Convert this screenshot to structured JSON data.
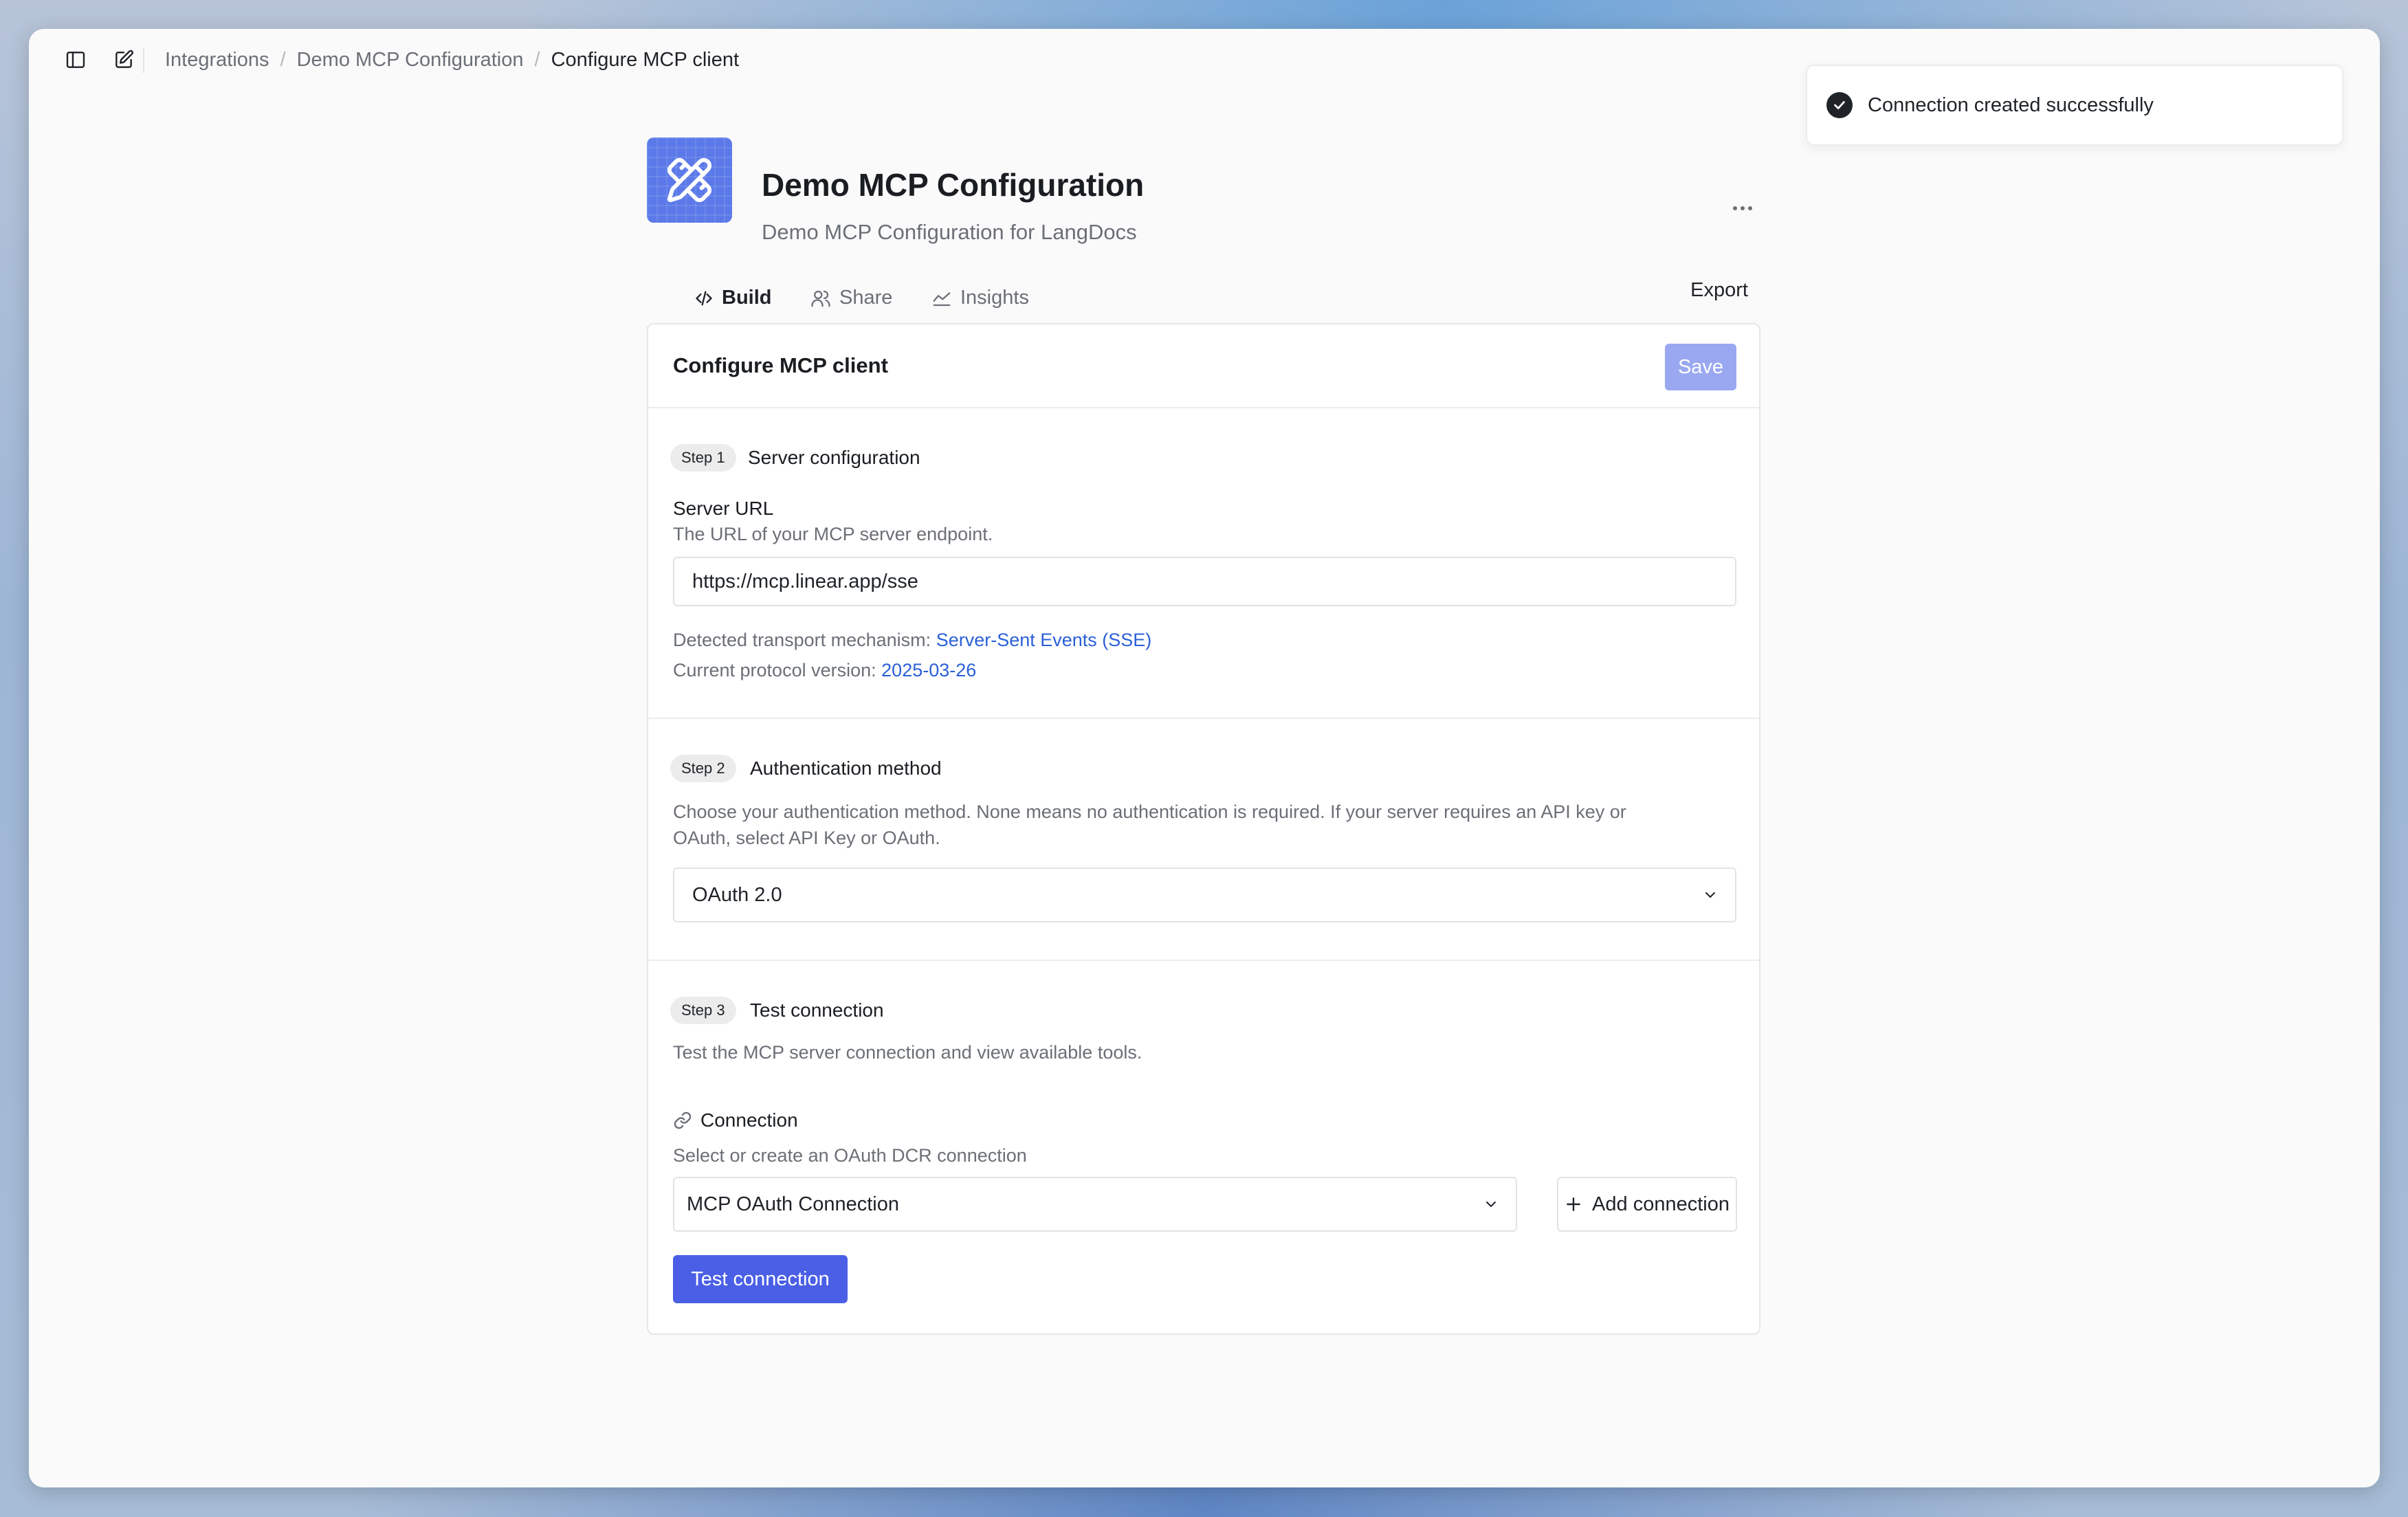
{
  "breadcrumb": {
    "items": [
      "Integrations",
      "Demo MCP Configuration"
    ],
    "current": "Configure MCP client"
  },
  "header": {
    "title": "Demo MCP Configuration",
    "subtitle": "Demo MCP Configuration for LangDocs",
    "logo_icon": "pencil-ruler-icon",
    "brand_color": "#5b79e8"
  },
  "tabs": [
    {
      "label": "Build",
      "icon": "code-icon",
      "active": true
    },
    {
      "label": "Share",
      "icon": "users-icon",
      "active": false
    },
    {
      "label": "Insights",
      "icon": "chart-line-icon",
      "active": false
    }
  ],
  "export_label": "Export",
  "card": {
    "title": "Configure MCP client",
    "save_label": "Save"
  },
  "step1": {
    "badge": "Step 1",
    "title": "Server configuration",
    "field_label": "Server URL",
    "field_help": "The URL of your MCP server endpoint.",
    "url_value": "https://mcp.linear.app/sse",
    "transport_label": "Detected transport mechanism:",
    "transport_value": "Server-Sent Events (SSE)",
    "protocol_label": "Current protocol version:",
    "protocol_value": "2025-03-26"
  },
  "step2": {
    "badge": "Step 2",
    "title": "Authentication method",
    "help_line1": "Choose your authentication method. None means no authentication is required. If your server requires an API key or",
    "help_line2": "OAuth, select API Key or OAuth.",
    "selected": "OAuth 2.0"
  },
  "step3": {
    "badge": "Step 3",
    "title": "Test connection",
    "help": "Test the MCP server connection and view available tools.",
    "connection_label": "Connection",
    "connection_help": "Select or create an OAuth DCR connection",
    "connection_selected": "MCP OAuth Connection",
    "add_label": "Add connection",
    "test_label": "Test connection"
  },
  "toast": {
    "message": "Connection created successfully"
  },
  "colors": {
    "accent": "#4a5fe6",
    "link": "#2b5fd9",
    "save_disabled": "#9aa8f2"
  }
}
